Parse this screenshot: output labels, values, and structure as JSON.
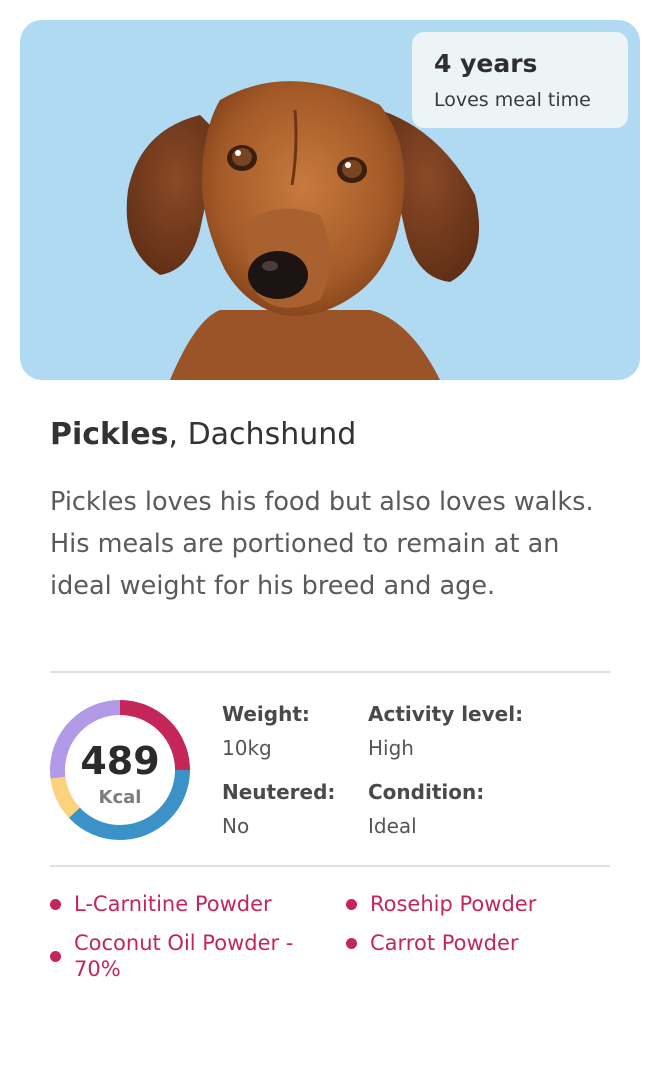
{
  "hero": {
    "badge": {
      "title": "4 years",
      "subtitle": "Loves meal time"
    },
    "background_color": "#afdaf2"
  },
  "pet": {
    "name": "Pickles",
    "breed_suffix": ", Dachshund",
    "description": "Pickles loves his food but also loves walks. His meals are portioned to remain at an ideal weight for his breed and age."
  },
  "calories": {
    "value": "489",
    "unit": "Kcal",
    "segments": [
      {
        "color": "#c5265a",
        "fraction": 0.25
      },
      {
        "color": "#3b92c6",
        "fraction": 0.38
      },
      {
        "color": "#fcd37c",
        "fraction": 0.1
      },
      {
        "color": "#b29ae8",
        "fraction": 0.27
      }
    ]
  },
  "stats": {
    "weight": {
      "label": "Weight:",
      "value": "10kg"
    },
    "activity": {
      "label": "Activity level:",
      "value": "High"
    },
    "neutered": {
      "label": "Neutered:",
      "value": "No"
    },
    "condition": {
      "label": "Condition:",
      "value": "Ideal"
    }
  },
  "ingredients": [
    "L-Carnitine Powder",
    "Rosehip Powder",
    "Coconut Oil Powder - 70%",
    "Carrot Powder"
  ],
  "colors": {
    "accent": "#c5265a",
    "divider": "#e0e0e0"
  }
}
